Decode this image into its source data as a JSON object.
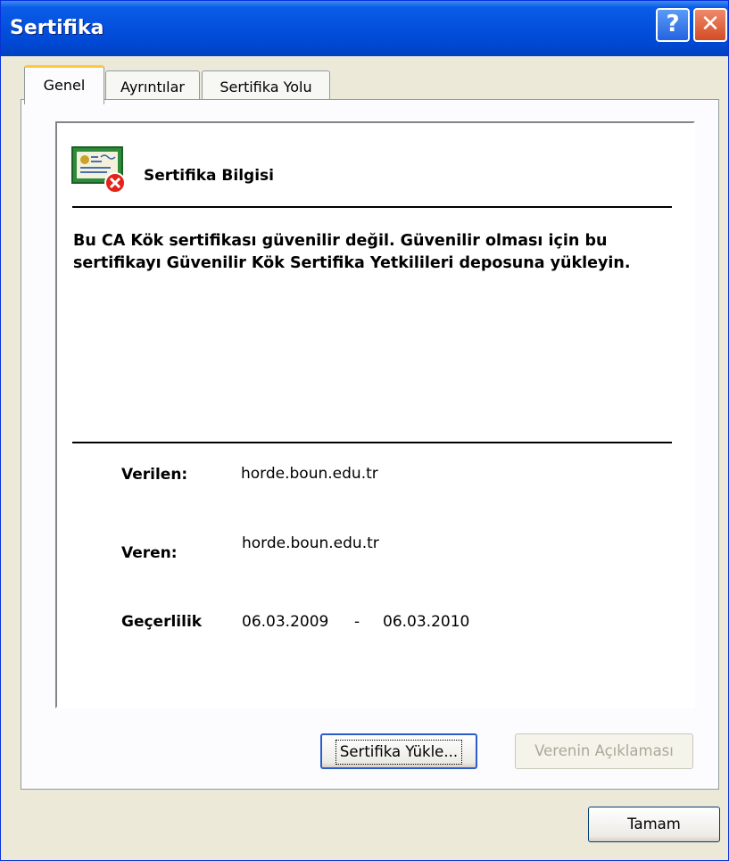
{
  "window": {
    "title": "Sertifika"
  },
  "titlebar": {
    "help_label": "?",
    "close_label": "✕"
  },
  "tabs": [
    {
      "label": "Genel",
      "active": true
    },
    {
      "label": "Ayrıntılar",
      "active": false
    },
    {
      "label": "Sertifika Yolu",
      "active": false
    }
  ],
  "cert": {
    "icon": "certificate-error-icon",
    "heading": "Sertifika Bilgisi",
    "message": "Bu CA Kök sertifikası güvenilir değil. Güvenilir olması için bu sertifikayı Güvenilir Kök Sertifika Yetkilileri deposuna yükleyin.",
    "issued_to_label": "Verilen:",
    "issued_to": "horde.boun.edu.tr",
    "issued_by_label": "Veren:",
    "issued_by": "horde.boun.edu.tr",
    "validity_label": "Geçerlilik",
    "valid_from": "06.03.2009",
    "validity_separator": "-",
    "valid_to": "06.03.2010"
  },
  "buttons": {
    "install": "Sertifika Yükle...",
    "issuer_statement": "Verenin Açıklaması",
    "ok": "Tamam"
  }
}
